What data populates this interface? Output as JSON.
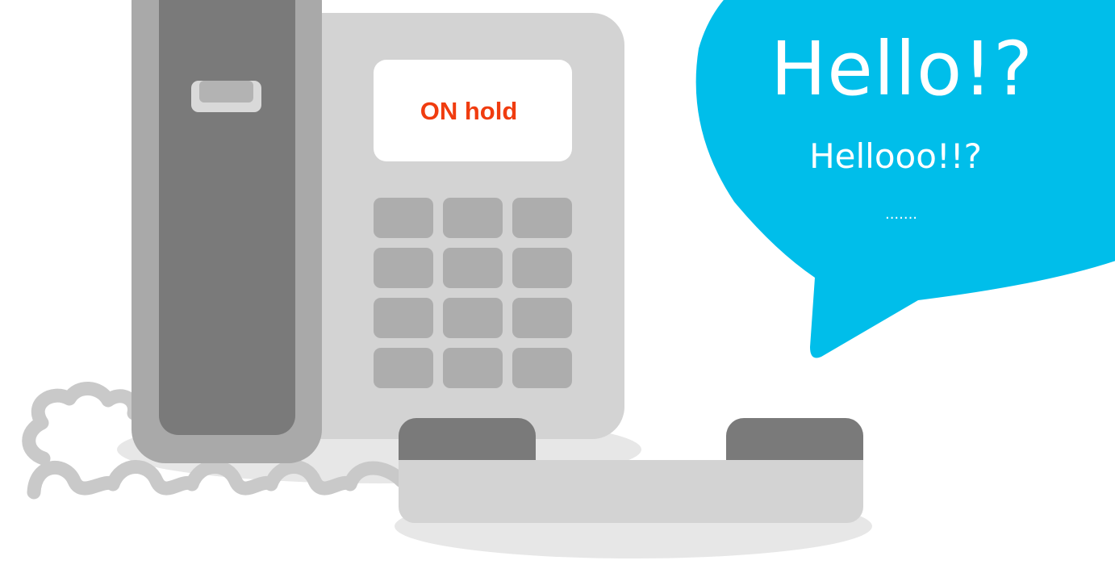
{
  "phone": {
    "display_text": "ON hold",
    "keypad_key_count": 12
  },
  "speech_bubble": {
    "line_1": "Hello!?",
    "line_2": "Hellooo!!?",
    "line_3": "......."
  },
  "colors": {
    "display_text": "#F03C0F",
    "bubble": "#00BEEA",
    "bubble_text": "#FFFFFF",
    "phone_body": "#D3D3D3",
    "handset_dark": "#7A7A7A",
    "handset_frame": "#A9A9A9",
    "keys": "#ADADAD",
    "cord": "#C9C9C9",
    "shadow": "#E7E7E7"
  }
}
